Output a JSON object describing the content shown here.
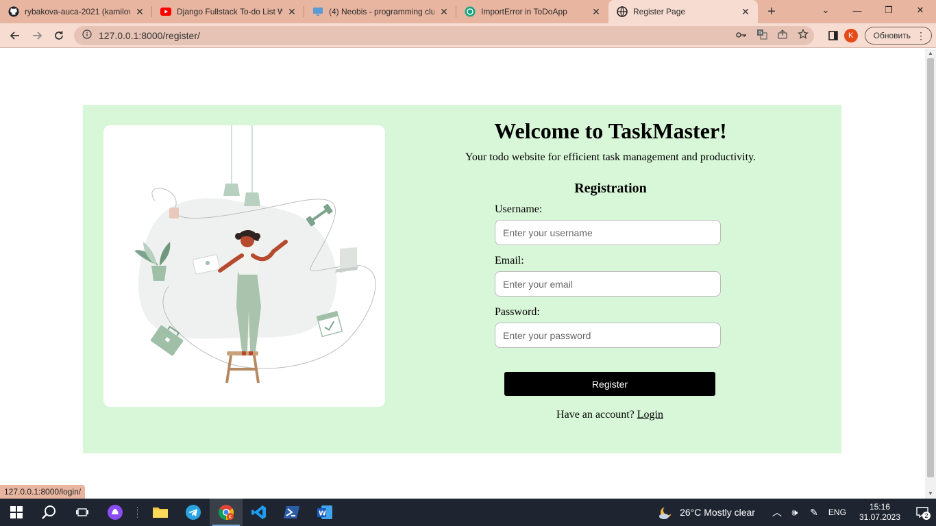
{
  "browser": {
    "tabs": [
      {
        "title": "rybakova-auca-2021 (kamilov",
        "icon": "github-icon"
      },
      {
        "title": "Django Fullstack To-do List W",
        "icon": "youtube-icon"
      },
      {
        "title": "(4) Neobis - programming clu",
        "icon": "monitor-icon"
      },
      {
        "title": "ImportError in ToDoApp",
        "icon": "chatgpt-icon"
      },
      {
        "title": "Register Page",
        "icon": "globe-icon"
      }
    ],
    "url": "127.0.0.1:8000/register/",
    "profile_initial": "K",
    "update_label": "Обновить",
    "status_url": "127.0.0.1:8000/login/"
  },
  "page": {
    "welcome": "Welcome to TaskMaster!",
    "tagline": "Your todo website for efficient task management and productivity.",
    "form_title": "Registration",
    "username_label": "Username:",
    "username_placeholder": "Enter your username",
    "email_label": "Email:",
    "email_placeholder": "Enter your email",
    "password_label": "Password:",
    "password_placeholder": "Enter your password",
    "register_label": "Register",
    "have_account": "Have an account?",
    "login_label": "Login"
  },
  "taskbar": {
    "weather": "26°C  Mostly clear",
    "language": "ENG",
    "time": "15:16",
    "date": "31.07.2023",
    "notification_count": "2"
  },
  "colors": {
    "card_bg": "#d8f6d8",
    "tab_strip": "#e8b5a0",
    "button_bg": "#000000"
  }
}
